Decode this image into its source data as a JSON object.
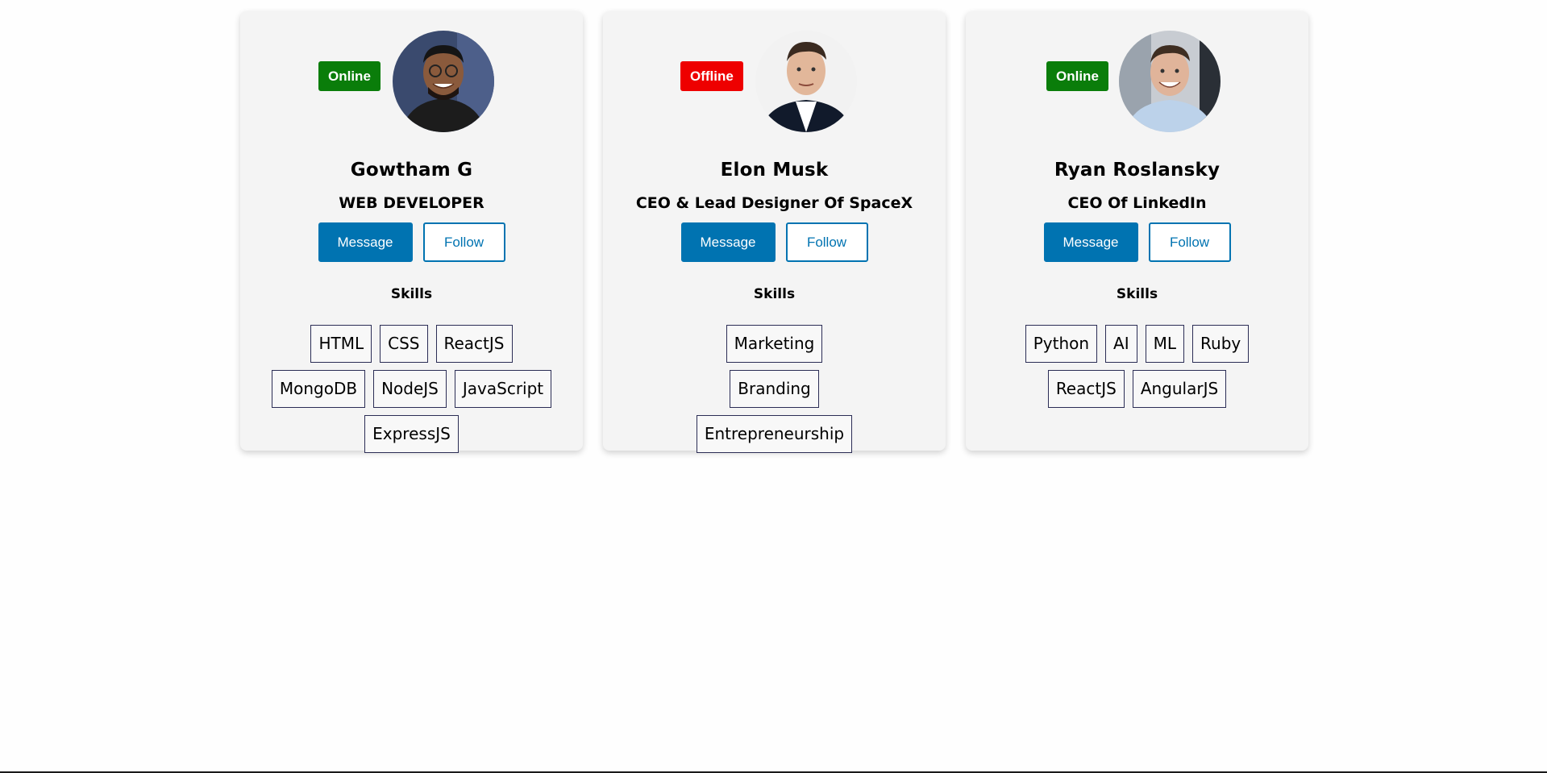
{
  "profiles": [
    {
      "name": "Gowtham G",
      "role": "WEB DEVELOPER",
      "status": "Online",
      "status_color": "#0a7d0a",
      "message_label": "Message",
      "follow_label": "Follow",
      "skills_title": "Skills",
      "skills": [
        "HTML",
        "CSS",
        "ReactJS",
        "MongoDB",
        "NodeJS",
        "JavaScript",
        "ExpressJS"
      ]
    },
    {
      "name": "Elon Musk",
      "role": "CEO & Lead Designer Of SpaceX",
      "status": "Offline",
      "status_color": "#ee0000",
      "message_label": "Message",
      "follow_label": "Follow",
      "skills_title": "Skills",
      "skills": [
        "Marketing",
        "Branding",
        "Entrepreneurship"
      ]
    },
    {
      "name": "Ryan Roslansky",
      "role": "CEO Of LinkedIn",
      "status": "Online",
      "status_color": "#0a7d0a",
      "message_label": "Message",
      "follow_label": "Follow",
      "skills_title": "Skills",
      "skills": [
        "Python",
        "AI",
        "ML",
        "Ruby",
        "ReactJS",
        "AngularJS"
      ]
    }
  ],
  "colors": {
    "primary": "#0073b1",
    "online": "#0a7d0a",
    "offline": "#ee0000",
    "card_bg": "#f4f4f4"
  }
}
